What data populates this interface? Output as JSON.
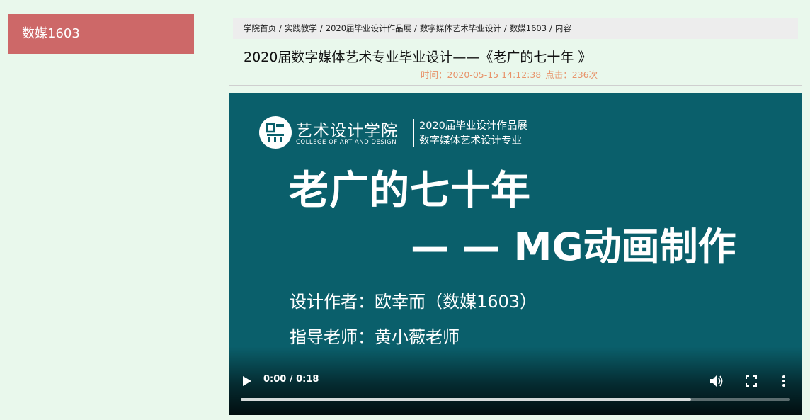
{
  "sidebar": {
    "active_item": "数媒1603"
  },
  "breadcrumb": {
    "items": [
      "学院首页",
      "实践教学",
      "2020届毕业设计作品展",
      "数字媒体艺术毕业设计",
      "数媒1603",
      "内容"
    ],
    "separator": "/"
  },
  "article": {
    "title": "2020届数字媒体艺术专业毕业设计——《老广的七十年 》",
    "time_text": "时间：2020-05-15 14:12:38",
    "clicks_text": "点击：236次"
  },
  "video": {
    "poster": {
      "college_name": "艺术设计学院",
      "college_name_en": "COLLEGE OF ART AND DESIGN",
      "expo_line1": "2020届毕业设计作品展",
      "expo_line2": "数字媒体艺术设计专业",
      "main_title": "老广的七十年",
      "sub_title": "— — MG动画制作",
      "author_line": "设计作者：欧幸而（数媒1603）",
      "advisor_line": "指导老师：黄小薇老师"
    },
    "controls": {
      "time_display": "0:00 / 0:18",
      "buffered_fraction": 0.82
    }
  },
  "colors": {
    "page_background": "#e9f8ec",
    "sidebar_active": "#cd6868",
    "breadcrumb_background": "#ededed",
    "meta_text": "#e8936a",
    "video_background": "#0a5f6b"
  },
  "icons": [
    "college-logo-icon",
    "play-icon",
    "volume-icon",
    "fullscreen-icon",
    "more-options-icon"
  ]
}
